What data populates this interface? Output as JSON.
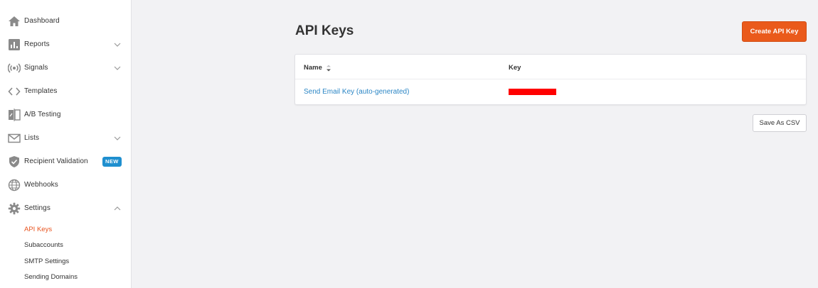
{
  "sidebar": {
    "items": [
      {
        "label": "Dashboard",
        "icon": "home-icon"
      },
      {
        "label": "Reports",
        "icon": "bar-chart-icon",
        "expandable": true
      },
      {
        "label": "Signals",
        "icon": "signal-icon",
        "expandable": true
      },
      {
        "label": "Templates",
        "icon": "code-icon"
      },
      {
        "label": "A/B Testing",
        "icon": "ab-test-icon"
      },
      {
        "label": "Lists",
        "icon": "envelope-icon",
        "expandable": true
      },
      {
        "label": "Recipient Validation",
        "icon": "shield-check-icon",
        "badge": "NEW"
      },
      {
        "label": "Webhooks",
        "icon": "globe-icon"
      },
      {
        "label": "Settings",
        "icon": "gear-icon",
        "expanded": true
      }
    ],
    "settings_sub": [
      {
        "label": "API Keys",
        "active": true
      },
      {
        "label": "Subaccounts"
      },
      {
        "label": "SMTP Settings"
      },
      {
        "label": "Sending Domains"
      }
    ]
  },
  "main": {
    "title": "API Keys",
    "create_button": "Create API Key",
    "table": {
      "headers": [
        "Name",
        "Key"
      ],
      "rows": [
        {
          "name": "Send Email Key (auto-generated)",
          "key": ""
        }
      ]
    },
    "csv_button": "Save As CSV"
  },
  "colors": {
    "accent": "#ea5a1b",
    "link": "#2b86c5",
    "badge": "#1f8fcf",
    "redaction": "#ff0000"
  }
}
